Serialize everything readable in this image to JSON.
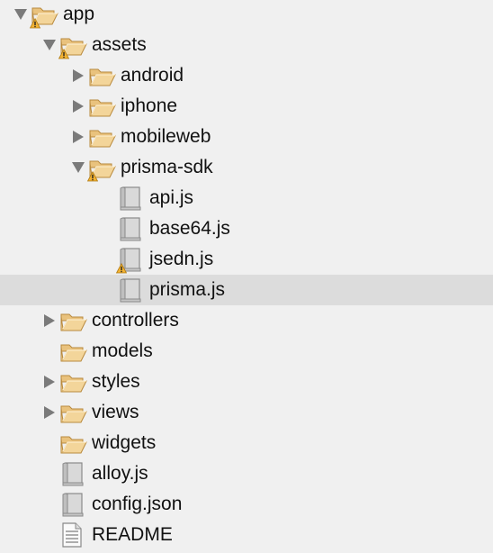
{
  "tree": {
    "selected_index": 9,
    "items": [
      {
        "label": "app",
        "type": "folder",
        "depth": 0,
        "expandable": true,
        "expanded": true,
        "warning": true
      },
      {
        "label": "assets",
        "type": "folder",
        "depth": 1,
        "expandable": true,
        "expanded": true,
        "warning": true
      },
      {
        "label": "android",
        "type": "folder",
        "depth": 2,
        "expandable": true,
        "expanded": false,
        "warning": false
      },
      {
        "label": "iphone",
        "type": "folder",
        "depth": 2,
        "expandable": true,
        "expanded": false,
        "warning": false
      },
      {
        "label": "mobileweb",
        "type": "folder",
        "depth": 2,
        "expandable": true,
        "expanded": false,
        "warning": false
      },
      {
        "label": "prisma-sdk",
        "type": "folder",
        "depth": 2,
        "expandable": true,
        "expanded": true,
        "warning": true
      },
      {
        "label": "api.js",
        "type": "script-file",
        "depth": 3,
        "expandable": false,
        "warning": false
      },
      {
        "label": "base64.js",
        "type": "script-file",
        "depth": 3,
        "expandable": false,
        "warning": false
      },
      {
        "label": "jsedn.js",
        "type": "script-file",
        "depth": 3,
        "expandable": false,
        "warning": true
      },
      {
        "label": "prisma.js",
        "type": "script-file",
        "depth": 3,
        "expandable": false,
        "warning": false
      },
      {
        "label": "controllers",
        "type": "folder",
        "depth": 1,
        "expandable": true,
        "expanded": false,
        "warning": false
      },
      {
        "label": "models",
        "type": "folder",
        "depth": 1,
        "expandable": false,
        "warning": false
      },
      {
        "label": "styles",
        "type": "folder",
        "depth": 1,
        "expandable": true,
        "expanded": false,
        "warning": false
      },
      {
        "label": "views",
        "type": "folder",
        "depth": 1,
        "expandable": true,
        "expanded": false,
        "warning": false
      },
      {
        "label": "widgets",
        "type": "folder",
        "depth": 1,
        "expandable": false,
        "warning": false
      },
      {
        "label": "alloy.js",
        "type": "script-file",
        "depth": 1,
        "expandable": false,
        "warning": false
      },
      {
        "label": "config.json",
        "type": "script-file",
        "depth": 1,
        "expandable": false,
        "warning": false
      },
      {
        "label": "README",
        "type": "text-file",
        "depth": 1,
        "expandable": false,
        "warning": false
      }
    ]
  },
  "colors": {
    "background": "#f0f0f0",
    "selection": "#dcdcdc",
    "twisty": "#7a7a7a",
    "folder": "#f3d59a",
    "warning": "#f2b233"
  }
}
